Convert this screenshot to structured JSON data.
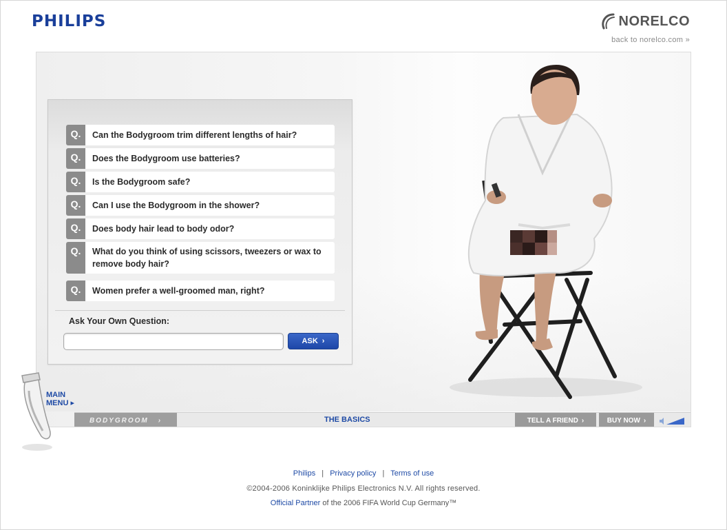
{
  "header": {
    "brand_left": "PHILIPS",
    "brand_right": "NORELCO",
    "back_link": "back to norelco.com »"
  },
  "qa": {
    "questions": [
      {
        "badge": "Q.",
        "text": "Can the Bodygroom trim different lengths of hair?"
      },
      {
        "badge": "Q.",
        "text": "Does the Bodygroom use batteries?"
      },
      {
        "badge": "Q.",
        "text": "Is the Bodygroom safe?"
      },
      {
        "badge": "Q.",
        "text": "Can I use the Bodygroom in the shower?"
      },
      {
        "badge": "Q.",
        "text": "Does body hair lead to body odor?"
      },
      {
        "badge": "Q.",
        "text": "What do you think of using scissors, tweezers or wax to remove body hair?"
      },
      {
        "badge": "Q.",
        "text": "Women prefer a well-groomed man, right?"
      }
    ],
    "ask_label": "Ask Your Own Question:",
    "ask_input_value": "",
    "ask_button": "ASK"
  },
  "nav": {
    "brand": "BODYGROOM",
    "section_title": "THE BASICS",
    "tell_a_friend": "TELL A FRIEND",
    "buy_now": "BUY NOW",
    "main_menu_line1": "MAIN",
    "main_menu_line2": "MENU"
  },
  "footer": {
    "links": [
      "Philips",
      "Privacy policy",
      "Terms of use"
    ],
    "separator": "|",
    "copyright": "©2004-2006 Koninklijke Philips Electronics N.V. All rights reserved.",
    "partner_link": "Official Partner",
    "partner_text": " of the 2006 FIFA World Cup Germany™"
  },
  "colors": {
    "brand_blue": "#1a3f9a",
    "link_blue": "#1e4aa5",
    "badge_gray": "#8b8b8b"
  },
  "icons": {
    "arrow": "›",
    "menu_arrow": "▸"
  }
}
